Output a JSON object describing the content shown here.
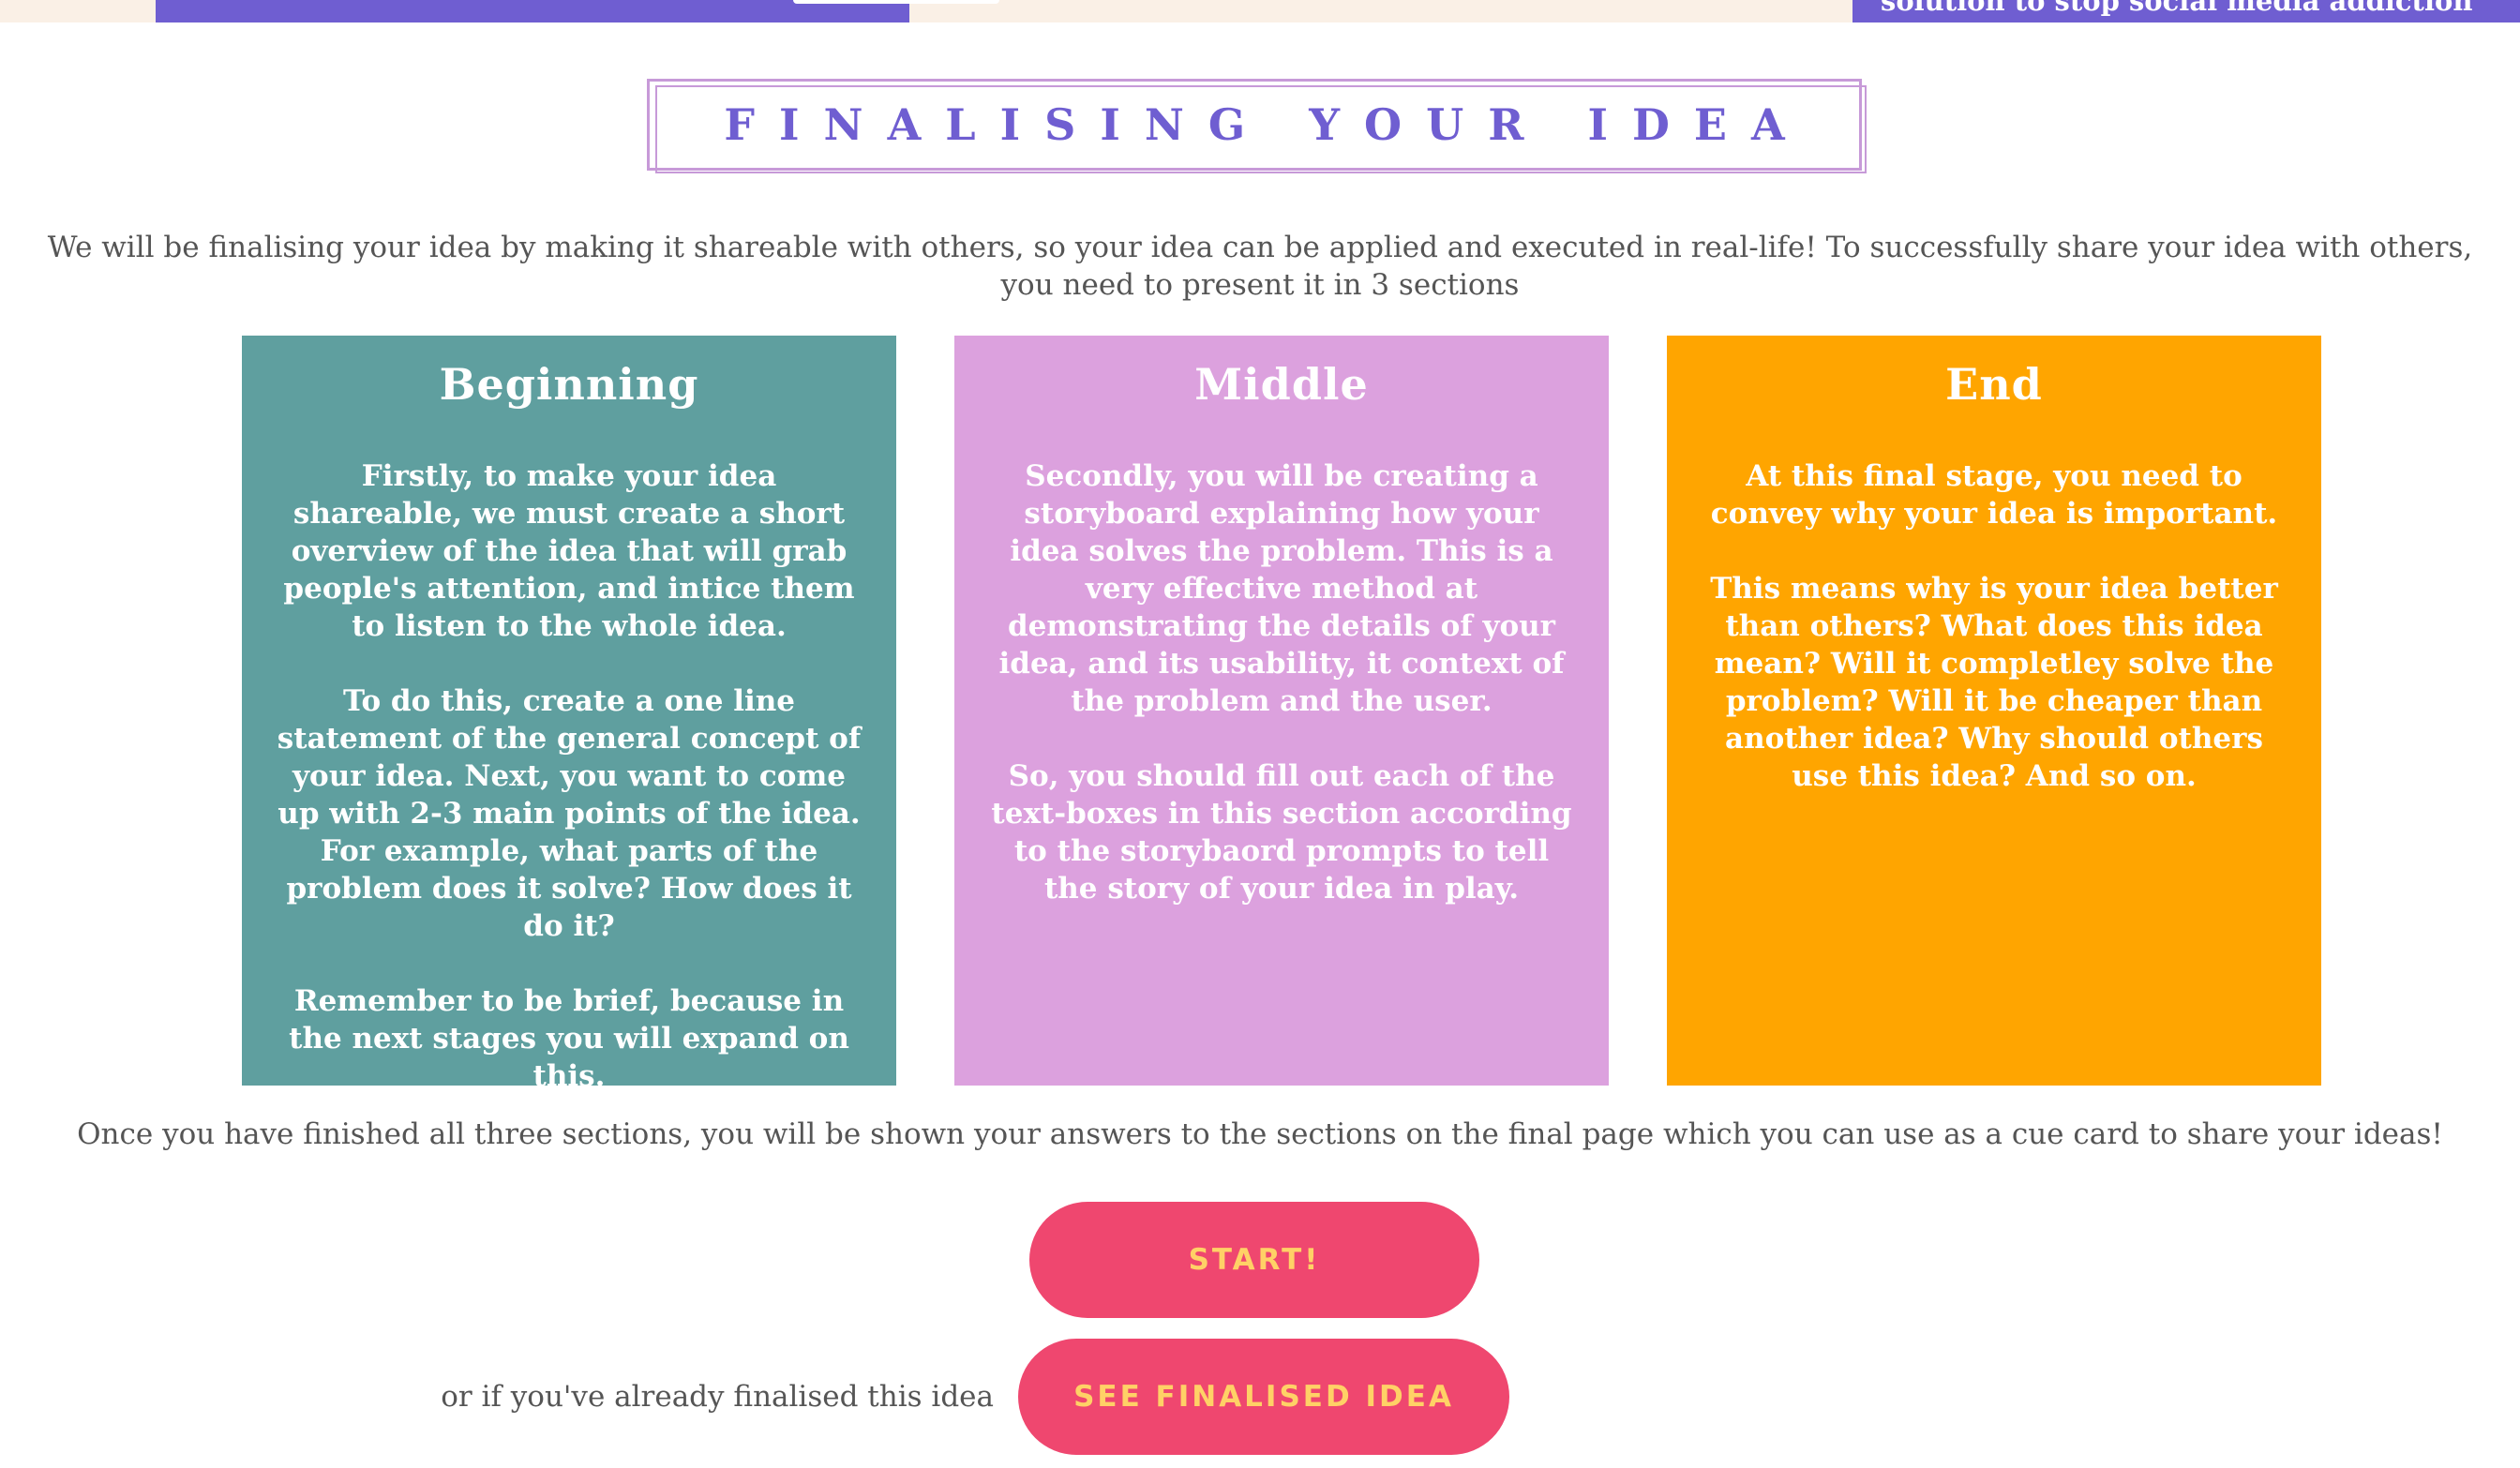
{
  "header": {
    "right_banner_text": "solution to stop social media addiction"
  },
  "page": {
    "title": "FINALISING YOUR IDEA",
    "intro": "We will be finalising your idea by making it shareable with others, so your idea can be applied and executed in real-life! To successfully share your idea with others, you need to present it in 3 sections"
  },
  "cards": [
    {
      "title": "Beginning",
      "paragraphs": [
        "Firstly, to make your idea shareable, we must create a short overview of the idea that will grab people's attention, and intice them to listen to the whole idea.",
        "To do this, create a one line statement of the general concept of your idea. Next, you want to come up with 2-3 main points of the idea. For example, what parts of the problem does it solve? How does it do it?",
        "Remember to be brief, because in the next stages you will expand on this."
      ]
    },
    {
      "title": "Middle",
      "paragraphs": [
        "Secondly, you will be creating a storyboard explaining how your idea solves the problem. This is a very effective method at demonstrating the details of your idea, and its usability, it context of the problem and the user.",
        "So, you should fill out each of the text-boxes in this section according to the storybaord prompts to tell the story of your idea in play."
      ]
    },
    {
      "title": "End",
      "paragraphs": [
        "At this final stage, you need to convey why your idea is important.",
        "This means why is your idea better than others? What does this idea mean? Will it completley solve the problem? Will it be cheaper than another idea? Why should others use this idea? And so on."
      ]
    }
  ],
  "bottom_note": "Once you have finished all three sections, you will be shown your answers to the sections on the final page which you can use as a cue card to share your ideas!",
  "actions": {
    "start_label": "START!",
    "or_text": "or if you've already finalised this idea",
    "see_finalised_label": "SEE FINALISED IDEA"
  },
  "colors": {
    "purple": "#6f5ed1",
    "teal": "#5f9f9f",
    "lilac": "#dca1de",
    "orange": "#ffa500",
    "button_bg": "#ef476f",
    "button_text": "#ffd166"
  }
}
